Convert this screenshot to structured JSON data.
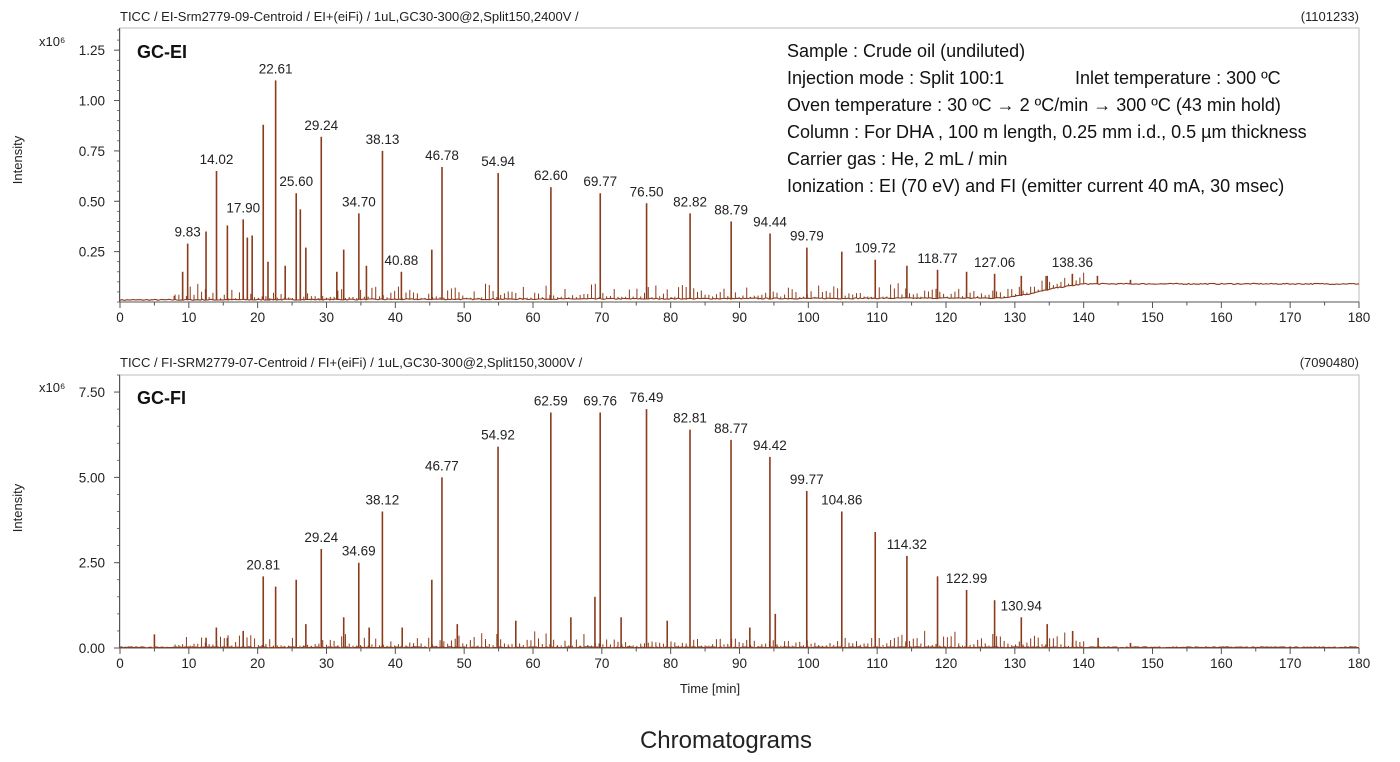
{
  "figure_caption": "Chromatograms",
  "colors": {
    "trace": "#8B3A1A",
    "axis": "#555555",
    "text": "#222222"
  },
  "chart_data": [
    {
      "type": "line",
      "panel": "GC-EI",
      "header_left": "TICC / EI-Srm2779-09-Centroid / EI+(eiFi) / 1uL,GC30-300@2,Split150,2400V /",
      "header_right": "(1101233)",
      "scale_label": "x10⁶",
      "ylabel": "Intensity",
      "xlabel": "",
      "xlim": [
        0,
        180
      ],
      "ylim": [
        0,
        1.36
      ],
      "x_ticks": [
        "0",
        "10",
        "20",
        "30",
        "40",
        "50",
        "60",
        "70",
        "80",
        "90",
        "100",
        "110",
        "120",
        "130",
        "140",
        "150",
        "160",
        "170",
        "180"
      ],
      "y_ticks": [
        "0.25",
        "0.50",
        "0.75",
        "1.00",
        "1.25"
      ],
      "info_lines": [
        "Sample : Crude oil (undiluted)",
        "Injection mode : Split 100:1",
        "Inlet temperature : 300 ºC",
        "Oven temperature :  30 ºC → 2 ºC/min → 300 ºC (43 min hold)",
        "Column : For DHA , 100 m length, 0.25 mm i.d., 0.5 µm thickness",
        "Carrier gas : He, 2 mL / min",
        "Ionization : EI (70 eV) and FI (emitter current 40 mA, 30 msec)"
      ],
      "baseline": {
        "x": [
          0,
          128,
          132,
          136,
          140,
          180
        ],
        "y": [
          0.01,
          0.02,
          0.04,
          0.07,
          0.09,
          0.09
        ]
      },
      "peaks": [
        {
          "x": 7.9,
          "y": 0.03
        },
        {
          "x": 9.1,
          "y": 0.15
        },
        {
          "x": 9.83,
          "y": 0.29
        },
        {
          "x": 12.5,
          "y": 0.35
        },
        {
          "x": 14.02,
          "y": 0.65
        },
        {
          "x": 15.6,
          "y": 0.38
        },
        {
          "x": 17.9,
          "y": 0.41
        },
        {
          "x": 18.5,
          "y": 0.32
        },
        {
          "x": 19.2,
          "y": 0.33
        },
        {
          "x": 20.81,
          "y": 0.88
        },
        {
          "x": 21.5,
          "y": 0.2
        },
        {
          "x": 22.61,
          "y": 1.1
        },
        {
          "x": 24.0,
          "y": 0.18
        },
        {
          "x": 25.6,
          "y": 0.54
        },
        {
          "x": 26.2,
          "y": 0.46
        },
        {
          "x": 27.0,
          "y": 0.27
        },
        {
          "x": 29.24,
          "y": 0.82
        },
        {
          "x": 31.5,
          "y": 0.15
        },
        {
          "x": 32.5,
          "y": 0.26
        },
        {
          "x": 34.7,
          "y": 0.44
        },
        {
          "x": 35.8,
          "y": 0.18
        },
        {
          "x": 38.13,
          "y": 0.75
        },
        {
          "x": 40.88,
          "y": 0.15
        },
        {
          "x": 45.3,
          "y": 0.26
        },
        {
          "x": 46.78,
          "y": 0.67
        },
        {
          "x": 54.94,
          "y": 0.64
        },
        {
          "x": 62.6,
          "y": 0.57
        },
        {
          "x": 69.77,
          "y": 0.54
        },
        {
          "x": 76.5,
          "y": 0.49
        },
        {
          "x": 82.82,
          "y": 0.44
        },
        {
          "x": 88.79,
          "y": 0.4
        },
        {
          "x": 94.44,
          "y": 0.34
        },
        {
          "x": 99.79,
          "y": 0.27
        },
        {
          "x": 104.86,
          "y": 0.25
        },
        {
          "x": 109.72,
          "y": 0.21
        },
        {
          "x": 114.32,
          "y": 0.18
        },
        {
          "x": 118.77,
          "y": 0.16
        },
        {
          "x": 122.99,
          "y": 0.15
        },
        {
          "x": 127.06,
          "y": 0.14
        },
        {
          "x": 130.94,
          "y": 0.13
        },
        {
          "x": 134.7,
          "y": 0.13
        },
        {
          "x": 138.36,
          "y": 0.14
        },
        {
          "x": 142.0,
          "y": 0.13
        },
        {
          "x": 146.8,
          "y": 0.11
        }
      ],
      "peak_labels": [
        {
          "x": 9.83,
          "y": 0.29,
          "text": "9.83"
        },
        {
          "x": 14.02,
          "y": 0.65,
          "text": "14.02"
        },
        {
          "x": 17.9,
          "y": 0.41,
          "text": "17.90"
        },
        {
          "x": 22.61,
          "y": 1.1,
          "text": "22.61"
        },
        {
          "x": 25.6,
          "y": 0.54,
          "text": "25.60"
        },
        {
          "x": 29.24,
          "y": 0.82,
          "text": "29.24"
        },
        {
          "x": 34.7,
          "y": 0.44,
          "text": "34.70"
        },
        {
          "x": 38.13,
          "y": 0.75,
          "text": "38.13"
        },
        {
          "x": 40.88,
          "y": 0.15,
          "text": "40.88"
        },
        {
          "x": 46.78,
          "y": 0.67,
          "text": "46.78"
        },
        {
          "x": 54.94,
          "y": 0.64,
          "text": "54.94"
        },
        {
          "x": 62.6,
          "y": 0.57,
          "text": "62.60"
        },
        {
          "x": 69.77,
          "y": 0.54,
          "text": "69.77"
        },
        {
          "x": 76.5,
          "y": 0.49,
          "text": "76.50"
        },
        {
          "x": 82.82,
          "y": 0.44,
          "text": "82.82"
        },
        {
          "x": 88.79,
          "y": 0.4,
          "text": "88.79"
        },
        {
          "x": 94.44,
          "y": 0.34,
          "text": "94.44"
        },
        {
          "x": 99.79,
          "y": 0.27,
          "text": "99.79"
        },
        {
          "x": 109.72,
          "y": 0.21,
          "text": "109.72"
        },
        {
          "x": 118.77,
          "y": 0.16,
          "text": "118.77"
        },
        {
          "x": 127.06,
          "y": 0.14,
          "text": "127.06"
        },
        {
          "x": 138.36,
          "y": 0.14,
          "text": "138.36"
        }
      ]
    },
    {
      "type": "line",
      "panel": "GC-FI",
      "header_left": "TICC / FI-SRM2779-07-Centroid / FI+(eiFi) / 1uL,GC30-300@2,Split150,3000V /",
      "header_right": "(7090480)",
      "scale_label": "x10⁶",
      "ylabel": "Intensity",
      "xlabel": "Time [min]",
      "xlim": [
        0,
        180
      ],
      "ylim": [
        0,
        8.0
      ],
      "x_ticks": [
        "0",
        "10",
        "20",
        "30",
        "40",
        "50",
        "60",
        "70",
        "80",
        "90",
        "100",
        "110",
        "120",
        "130",
        "140",
        "150",
        "160",
        "170",
        "180"
      ],
      "y_ticks": [
        "0.00",
        "2.50",
        "5.00",
        "7.50"
      ],
      "baseline": {
        "x": [
          0,
          180
        ],
        "y": [
          0.02,
          0.02
        ]
      },
      "peaks": [
        {
          "x": 5.0,
          "y": 0.4
        },
        {
          "x": 12.5,
          "y": 0.3
        },
        {
          "x": 14.0,
          "y": 0.6
        },
        {
          "x": 15.6,
          "y": 0.3
        },
        {
          "x": 17.9,
          "y": 0.5
        },
        {
          "x": 20.81,
          "y": 2.1
        },
        {
          "x": 22.61,
          "y": 1.8
        },
        {
          "x": 25.6,
          "y": 2.0
        },
        {
          "x": 27.0,
          "y": 0.7
        },
        {
          "x": 29.24,
          "y": 2.9
        },
        {
          "x": 32.5,
          "y": 0.9
        },
        {
          "x": 34.69,
          "y": 2.5
        },
        {
          "x": 36.2,
          "y": 0.6
        },
        {
          "x": 38.12,
          "y": 4.0
        },
        {
          "x": 41.0,
          "y": 0.6
        },
        {
          "x": 45.3,
          "y": 2.0
        },
        {
          "x": 46.77,
          "y": 5.0
        },
        {
          "x": 49.0,
          "y": 0.7
        },
        {
          "x": 54.92,
          "y": 5.9
        },
        {
          "x": 57.5,
          "y": 0.8
        },
        {
          "x": 62.59,
          "y": 6.9
        },
        {
          "x": 65.5,
          "y": 0.9
        },
        {
          "x": 69.0,
          "y": 1.5
        },
        {
          "x": 69.76,
          "y": 6.9
        },
        {
          "x": 72.8,
          "y": 0.9
        },
        {
          "x": 76.49,
          "y": 7.0
        },
        {
          "x": 79.5,
          "y": 0.8
        },
        {
          "x": 82.81,
          "y": 6.4
        },
        {
          "x": 88.77,
          "y": 6.1
        },
        {
          "x": 91.5,
          "y": 0.6
        },
        {
          "x": 94.42,
          "y": 5.6
        },
        {
          "x": 95.2,
          "y": 1.0
        },
        {
          "x": 99.77,
          "y": 4.6
        },
        {
          "x": 104.86,
          "y": 4.0
        },
        {
          "x": 109.72,
          "y": 3.4
        },
        {
          "x": 114.32,
          "y": 2.7
        },
        {
          "x": 118.77,
          "y": 2.1
        },
        {
          "x": 122.99,
          "y": 1.7
        },
        {
          "x": 127.06,
          "y": 1.4
        },
        {
          "x": 130.94,
          "y": 0.9
        },
        {
          "x": 134.7,
          "y": 0.7
        },
        {
          "x": 138.4,
          "y": 0.5
        },
        {
          "x": 142.1,
          "y": 0.3
        },
        {
          "x": 146.8,
          "y": 0.15
        }
      ],
      "peak_labels": [
        {
          "x": 20.81,
          "y": 2.1,
          "text": "20.81"
        },
        {
          "x": 29.24,
          "y": 2.9,
          "text": "29.24"
        },
        {
          "x": 34.69,
          "y": 2.5,
          "text": "34.69"
        },
        {
          "x": 38.12,
          "y": 4.0,
          "text": "38.12"
        },
        {
          "x": 46.77,
          "y": 5.0,
          "text": "46.77"
        },
        {
          "x": 54.92,
          "y": 5.9,
          "text": "54.92"
        },
        {
          "x": 62.59,
          "y": 6.9,
          "text": "62.59"
        },
        {
          "x": 69.76,
          "y": 6.9,
          "text": "69.76"
        },
        {
          "x": 76.49,
          "y": 7.0,
          "text": "76.49"
        },
        {
          "x": 82.81,
          "y": 6.4,
          "text": "82.81"
        },
        {
          "x": 88.77,
          "y": 6.1,
          "text": "88.77"
        },
        {
          "x": 94.42,
          "y": 5.6,
          "text": "94.42"
        },
        {
          "x": 99.77,
          "y": 4.6,
          "text": "99.77"
        },
        {
          "x": 104.86,
          "y": 4.0,
          "text": "104.86"
        },
        {
          "x": 114.32,
          "y": 2.7,
          "text": "114.32"
        },
        {
          "x": 122.99,
          "y": 1.7,
          "text": "122.99"
        },
        {
          "x": 130.94,
          "y": 0.9,
          "text": "130.94"
        }
      ]
    }
  ]
}
